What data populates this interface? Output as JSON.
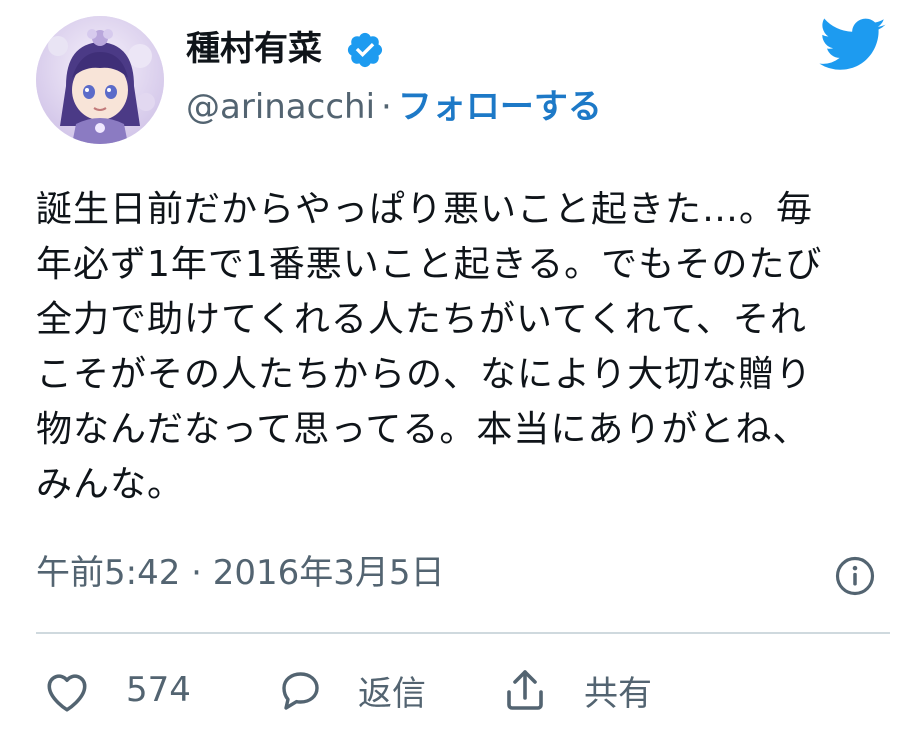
{
  "author": {
    "name": "種村有菜",
    "handle": "@arinacchi",
    "separator": "·",
    "follow_label": "フォローする"
  },
  "tweet": {
    "text": "誕生日前だからやっぱり悪いこと起きた…。毎\n年必ず1年で1番悪いこと起きる。でもそのたび\n全力で助けてくれる人たちがいてくれて、それ\nこそがその人たちからの、なにより大切な贈り\n物なんだなって思ってる。本当にありがとね、\nみんな。",
    "timestamp": "午前5:42 · 2016年3月5日"
  },
  "actions": {
    "like_count": "574",
    "reply_label": "返信",
    "share_label": "共有"
  },
  "icons": {
    "verified": "verified-badge-icon",
    "brand": "twitter-bird-icon",
    "info": "info-icon",
    "like": "heart-icon",
    "reply": "speech-bubble-icon",
    "share": "share-upload-icon"
  },
  "colors": {
    "accent": "#1d9bf0",
    "follow": "#1d79c7",
    "muted": "#536471",
    "text": "#0f1419",
    "divider": "#cfd9de"
  }
}
